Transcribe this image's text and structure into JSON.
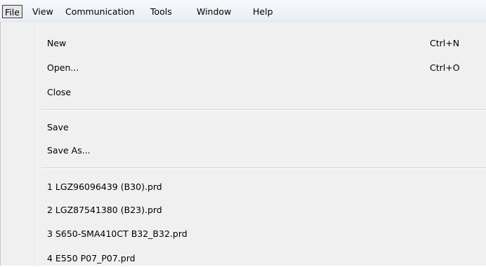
{
  "menubar": {
    "items": [
      {
        "label": "File"
      },
      {
        "label": "View"
      },
      {
        "label": "Communication"
      },
      {
        "label": "Tools"
      },
      {
        "label": "Window"
      },
      {
        "label": "Help"
      }
    ]
  },
  "file_menu": {
    "new": {
      "label": "New",
      "shortcut": "Ctrl+N"
    },
    "open": {
      "label": "Open...",
      "shortcut": "Ctrl+O"
    },
    "close": {
      "label": "Close"
    },
    "save": {
      "label": "Save"
    },
    "save_as": {
      "label": "Save As..."
    },
    "recent": [
      {
        "label": "1 LGZ96096439 (B30).prd"
      },
      {
        "label": "2 LGZ87541380 (B23).prd"
      },
      {
        "label": "3 S650-SMA410CT B32_B32.prd"
      },
      {
        "label": "4 E550 P07_P07.prd"
      }
    ]
  }
}
